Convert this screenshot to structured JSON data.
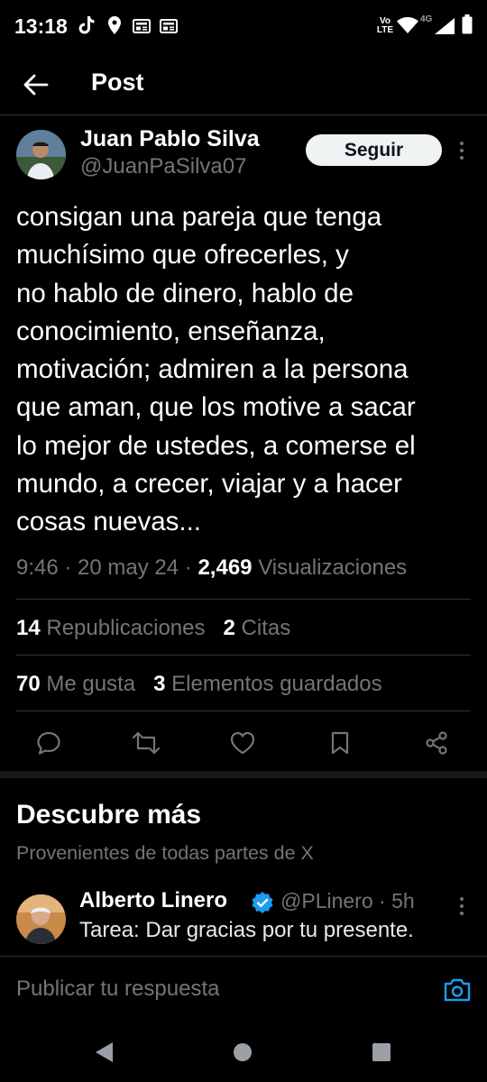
{
  "status_bar": {
    "time": "13:18",
    "network": "4G",
    "volte": "Vo\nLTE"
  },
  "header": {
    "title": "Post"
  },
  "tweet": {
    "author_name": "Juan Pablo Silva",
    "author_handle": "@JuanPaSilva07",
    "follow_label": "Seguir",
    "text": "consigan una pareja que tenga\nmuchísimo que ofrecerles, y\nno hablo de dinero, hablo de\nconocimiento, enseñanza,\nmotivación; admiren a la persona\nque aman, que los motive a sacar\nlo mejor de ustedes, a comerse el\nmundo, a crecer, viajar y a hacer\ncosas nuevas...",
    "time": "9:46",
    "date": "20 may 24",
    "views_count": "2,469",
    "views_label": "Visualizaciones",
    "reposts_count": "14",
    "reposts_label": "Republicaciones",
    "quotes_count": "2",
    "quotes_label": "Citas",
    "likes_count": "70",
    "likes_label": "Me gusta",
    "bookmarks_count": "3",
    "bookmarks_label": "Elementos guardados"
  },
  "discover": {
    "title": "Descubre más",
    "subtitle": "Provenientes de todas partes de X",
    "related": {
      "author_name": "Alberto Linero",
      "author_handle": "@PLinero",
      "age": "5h",
      "text": "Tarea: Dar gracias por tu presente."
    }
  },
  "reply": {
    "placeholder": "Publicar tu respuesta"
  },
  "colors": {
    "background": "#000000",
    "text_primary": "#e7e9ea",
    "text_secondary": "#71767b",
    "accent": "#1d9bf0",
    "divider": "#2f3336"
  },
  "icons": [
    "arrow-left-icon",
    "more-vertical-icon",
    "reply-icon",
    "repost-icon",
    "like-icon",
    "bookmark-icon",
    "share-icon",
    "verified-icon",
    "camera-icon",
    "nav-back-icon",
    "nav-home-icon",
    "nav-recents-icon"
  ]
}
